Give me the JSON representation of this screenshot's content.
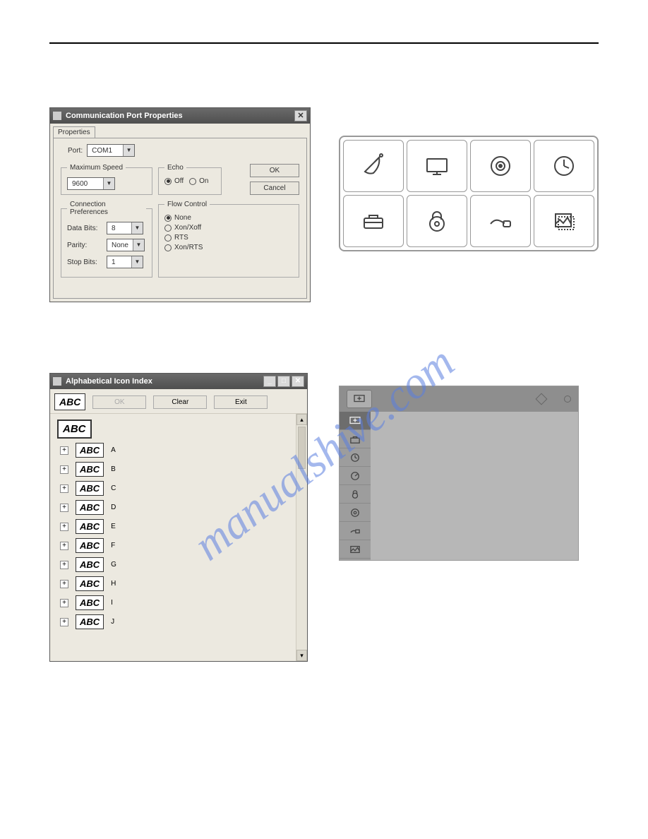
{
  "watermark": "manualshive.com",
  "dlg1": {
    "title": "Communication Port Properties",
    "tab": "Properties",
    "port_label": "Port:",
    "port_value": "COM1",
    "maxspeed_legend": "Maximum Speed",
    "maxspeed_value": "9600",
    "echo_legend": "Echo",
    "echo_off": "Off",
    "echo_on": "On",
    "ok": "OK",
    "cancel": "Cancel",
    "connpref_legend": "Connection Preferences",
    "databits_label": "Data Bits:",
    "databits_value": "8",
    "parity_label": "Parity:",
    "parity_value": "None",
    "stopbits_label": "Stop Bits:",
    "stopbits_value": "1",
    "flow_legend": "Flow Control",
    "flow_none": "None",
    "flow_xonxoff": "Xon/Xoff",
    "flow_rts": "RTS",
    "flow_xonrts": "Xon/RTS"
  },
  "icon_grid": {
    "row1": [
      "satellite-icon",
      "monitor-icon",
      "speaker-icon",
      "clock-icon"
    ],
    "row2": [
      "toolbox-icon",
      "lock-icon",
      "plug-icon",
      "picture-icon"
    ]
  },
  "dlg2": {
    "title": "Alphabetical Icon Index",
    "abc_btn": "ABC",
    "ok": "OK",
    "clear": "Clear",
    "exit": "Exit",
    "root": "ABC",
    "letters": [
      "A",
      "B",
      "C",
      "D",
      "E",
      "F",
      "G",
      "H",
      "I",
      "J"
    ],
    "item_label": "ABC",
    "plus": "+"
  },
  "submenu": {
    "side_icons": [
      "plus-monitor",
      "toolbox",
      "clock",
      "gauge",
      "lock",
      "speaker",
      "plug",
      "picture"
    ]
  }
}
